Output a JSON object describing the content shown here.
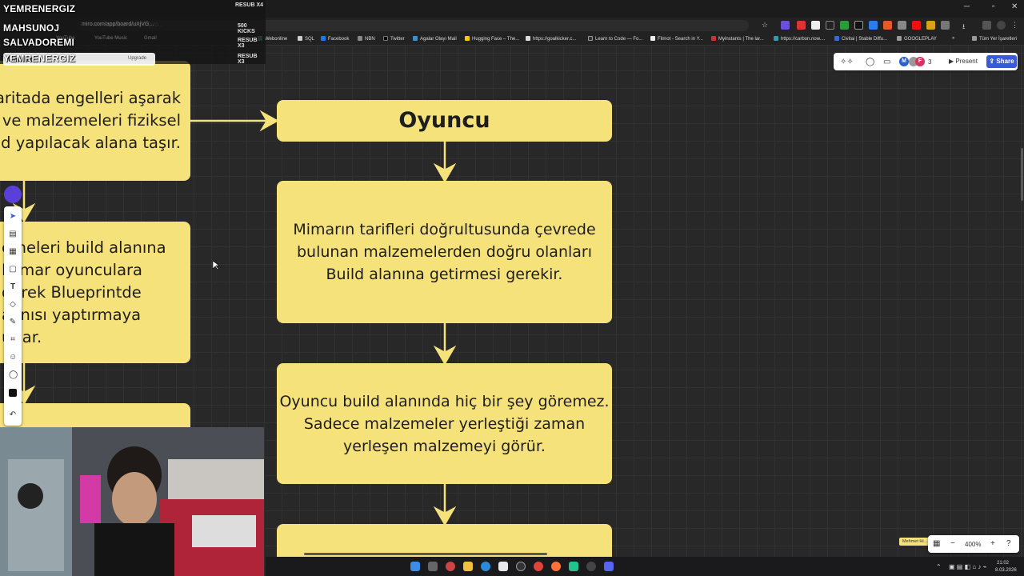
{
  "overlay": {
    "names": [
      "YEMRENERGIZ",
      "MAHSUNOJ",
      "SALVADOREMI",
      "YEMRENERGIZ"
    ],
    "tags": [
      "RESUB X4",
      "500 KICKS",
      "RESUB X3",
      "RESUB X3"
    ]
  },
  "browser": {
    "url": "miro.com/app/board/uXjVG...",
    "mini_tabs": [
      "YouTube",
      "YouTube Music",
      "Gmail"
    ],
    "board_title": "Untitled",
    "upgrade": "Upgrade",
    "bookmarks": [
      "Webonline",
      "SQL",
      "Facebook",
      "NBN",
      "Twitter",
      "Agalar Olayı Mail",
      "Hugging Face – The...",
      "https://goalkicker.c...",
      "Learn to Code — Fo...",
      "Filmot - Search in Y...",
      "Myinstants | The lar...",
      "https://carbon.now....",
      "Civitai | Stable Diffu...",
      "GOOGLEPLAY"
    ],
    "all_bookmarks": "Tüm Yer İşaretleri"
  },
  "topbar": {
    "present": "Present",
    "share": "Share",
    "avatar_count": "3",
    "avatar_initials": [
      "M",
      "F"
    ]
  },
  "cards": {
    "left1": "haritada engelleri aşarak\nve malzemeleri fiziksel\nuild yapılacak alana taşır.",
    "left2": "emeleri build alanına\nMimar oyunculara\nderek Blueprintde\naynısı yaptırmaya\nurlar.",
    "title": "Oyuncu",
    "card1": "Mimarın tarifleri doğrultusunda çevrede\nbulunan malzemelerden doğru olanları\nBuild alanına getirmesi gerekir.",
    "card2": "Oyuncu build alanında hiç bir şey göremez.\nSadece malzemeler yerleştiği zaman\nyerleşen malzemeyi görür."
  },
  "bottom": {
    "zoom": "400%",
    "cursor_label": "Mehmet Hi...",
    "time": "21:02",
    "date": "8.03.2026"
  }
}
